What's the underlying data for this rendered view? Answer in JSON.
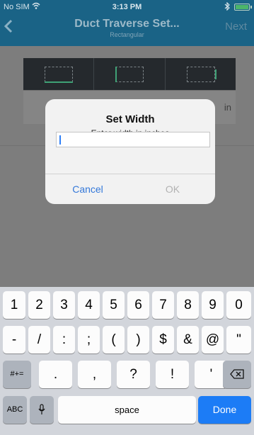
{
  "status_bar": {
    "carrier": "No SIM",
    "wifi_icon": "wifi-icon",
    "time": "3:13 PM",
    "bluetooth_icon": "bluetooth-icon",
    "battery_icon": "battery-icon"
  },
  "nav": {
    "back_icon": "chevron-left-icon",
    "title": "Duct Traverse Set...",
    "subtitle": "Rectangular",
    "next_label": "Next"
  },
  "duct_shapes": {
    "cells": [
      "width-highlight",
      "height-highlight",
      "depth-highlight"
    ]
  },
  "info_row": {
    "unit": "in"
  },
  "alert": {
    "title": "Set Width",
    "message": "Enter width in inches",
    "input_value": "",
    "cancel_label": "Cancel",
    "ok_label": "OK"
  },
  "keyboard": {
    "row1": [
      "1",
      "2",
      "3",
      "4",
      "5",
      "6",
      "7",
      "8",
      "9",
      "0"
    ],
    "row2": [
      "-",
      "/",
      ":",
      ";",
      "(",
      ")",
      "$",
      "&",
      "@",
      "\""
    ],
    "row3_left": "#+=",
    "row3": [
      ".",
      ",",
      "?",
      "!",
      "'"
    ],
    "backspace_icon": "backspace-icon",
    "abc_label": "ABC",
    "mic_icon": "microphone-icon",
    "space_label": "space",
    "done_label": "Done"
  },
  "colors": {
    "nav_bar": "#1a6386",
    "done_key": "#1c7cf6",
    "accent_green": "#3fa276"
  }
}
